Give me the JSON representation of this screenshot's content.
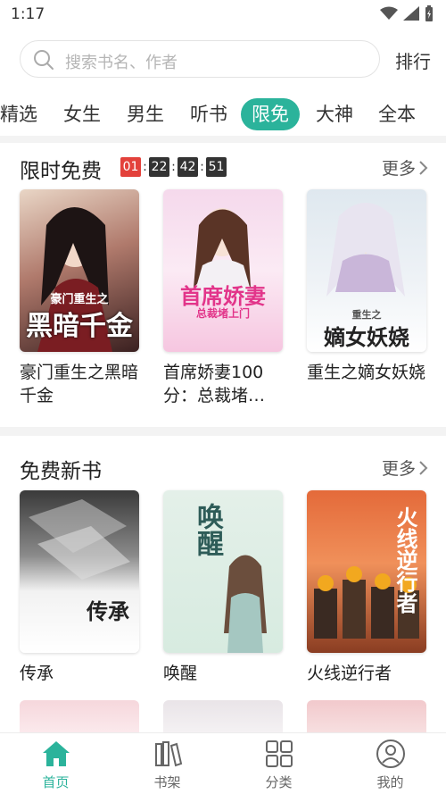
{
  "status_bar": {
    "time": "1:17"
  },
  "search": {
    "placeholder": "搜索书名、作者",
    "rank_label": "排行"
  },
  "tabs": [
    {
      "label": "精选"
    },
    {
      "label": "女生"
    },
    {
      "label": "男生"
    },
    {
      "label": "听书"
    },
    {
      "label": "限免",
      "active": true
    },
    {
      "label": "大神"
    },
    {
      "label": "全本"
    }
  ],
  "limited_free": {
    "title": "限时免费",
    "more": "更多",
    "countdown": {
      "hours": "01",
      "minutes": "22",
      "seconds": "42",
      "frames": "51"
    },
    "books": [
      {
        "title": "豪门重生之黑暗千金",
        "cover_text": "黑暗千金",
        "cover_sub": "豪门重生之"
      },
      {
        "title": "首席娇妻100分：总裁堵…",
        "cover_text": "首席娇妻",
        "cover_sub": "总裁堵上门"
      },
      {
        "title": "重生之嫡女妖娆",
        "cover_text": "嫡女妖娆",
        "cover_sub": "重生之"
      }
    ]
  },
  "new_free": {
    "title": "免费新书",
    "more": "更多",
    "books": [
      {
        "title": "传承",
        "cover_text": "传承"
      },
      {
        "title": "唤醒",
        "cover_text": "唤醒"
      },
      {
        "title": "火线逆行者",
        "cover_text": "火线逆行者"
      }
    ]
  },
  "bottom_nav": [
    {
      "label": "首页",
      "icon": "home-icon",
      "active": true
    },
    {
      "label": "书架",
      "icon": "bookshelf-icon"
    },
    {
      "label": "分类",
      "icon": "grid-icon"
    },
    {
      "label": "我的",
      "icon": "user-icon"
    }
  ],
  "colors": {
    "accent": "#2bb39b",
    "countdown_red": "#e3413b"
  }
}
